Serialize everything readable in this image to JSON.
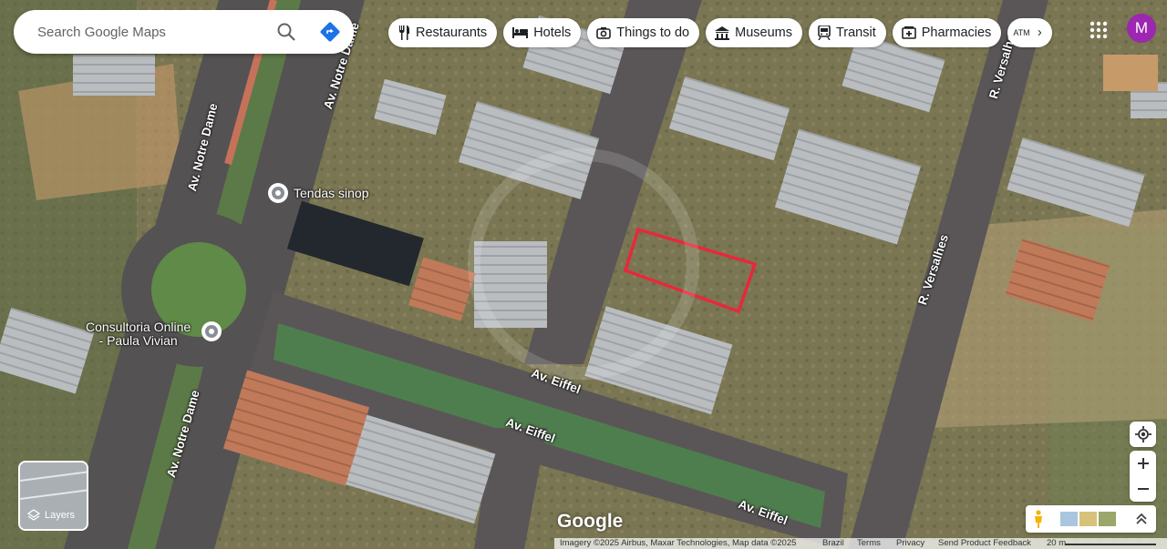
{
  "search": {
    "placeholder": "Search Google Maps"
  },
  "chips": [
    {
      "label": "Restaurants",
      "icon": "fork-knife-icon"
    },
    {
      "label": "Hotels",
      "icon": "bed-icon"
    },
    {
      "label": "Things to do",
      "icon": "camera-icon"
    },
    {
      "label": "Museums",
      "icon": "museum-icon"
    },
    {
      "label": "Transit",
      "icon": "train-icon"
    },
    {
      "label": "Pharmacies",
      "icon": "pharmacy-icon"
    },
    {
      "label": "ATMs",
      "icon": "atm-icon"
    }
  ],
  "account": {
    "initial": "M",
    "color": "#9c27b0"
  },
  "layers": {
    "label": "Layers"
  },
  "roads": {
    "notre_dame_top": "Av. Notre Dame",
    "notre_dame_left": "Av. Notre Dame",
    "notre_dame_bottom": "Av. Notre Dame",
    "versalhes_top": "R. Versalhes",
    "versalhes_mid": "R. Versalhes",
    "eiffel_1": "Av. Eiffel",
    "eiffel_2": "Av. Eiffel",
    "eiffel_3": "Av. Eiffel"
  },
  "pois": {
    "tendas": "Tendas sinop",
    "consultoria_line1": "Consultoria Online",
    "consultoria_line2": "- Paula Vivian"
  },
  "logo": "Google",
  "attribution": {
    "imagery": "Imagery ©2025 Airbus, Maxar Technologies, Map data ©2025",
    "country": "Brazil",
    "terms": "Terms",
    "privacy": "Privacy",
    "feedback": "Send Product Feedback",
    "scale": "20 m"
  },
  "highlight_color": "#e8283a"
}
